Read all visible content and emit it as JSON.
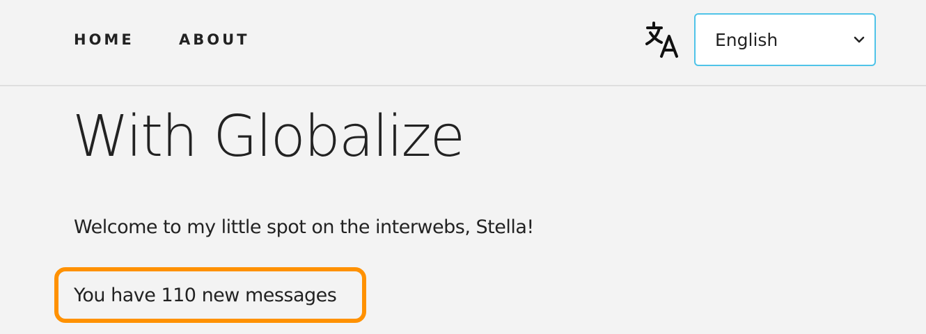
{
  "nav": {
    "items": [
      {
        "label": "HOME"
      },
      {
        "label": "ABOUT"
      }
    ]
  },
  "language": {
    "icon": "translate-icon",
    "selected": "English"
  },
  "main": {
    "title": "With Globalize",
    "welcome": "Welcome to my little spot on the interwebs, Stella!",
    "messages": "You have 110 new messages"
  },
  "colors": {
    "background": "#f3f3f3",
    "select_border": "#4fc3e8",
    "highlight_border": "#ff9100",
    "text": "#222222"
  }
}
